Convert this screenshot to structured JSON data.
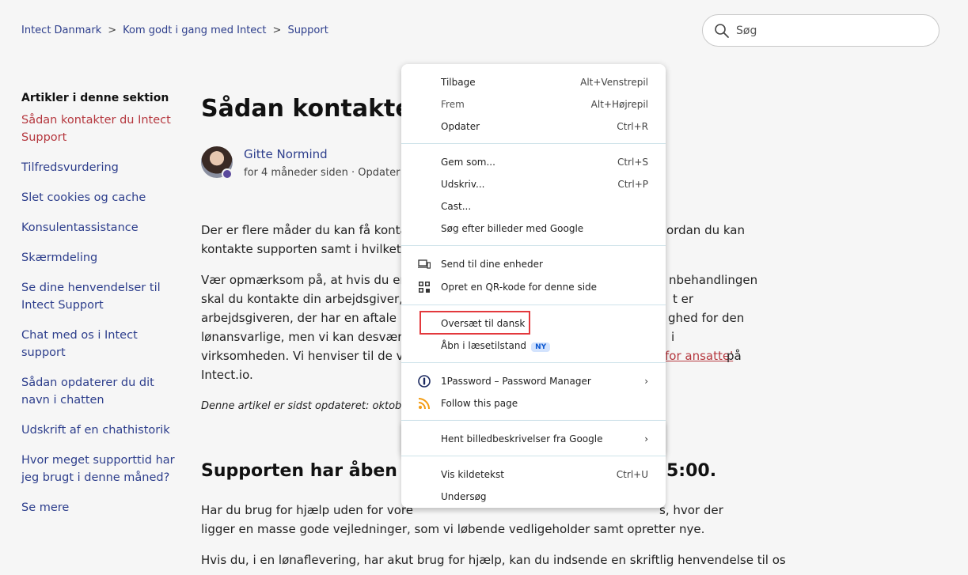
{
  "breadcrumb": {
    "item1": "Intect Danmark",
    "item2": "Kom godt i gang med Intect",
    "item3": "Support",
    "sep": ">"
  },
  "search": {
    "placeholder": "Søg"
  },
  "sidebar": {
    "heading": "Artikler i denne sektion",
    "items": [
      {
        "label": "Sådan kontakter du Intect Support"
      },
      {
        "label": "Tilfredsvurdering"
      },
      {
        "label": "Slet cookies og cache"
      },
      {
        "label": "Konsulentassistance"
      },
      {
        "label": "Skærmdeling"
      },
      {
        "label": "Se dine henvendelser til Intect Support"
      },
      {
        "label": "Chat med os i Intect support"
      },
      {
        "label": "Sådan opdaterer du dit navn i chatten"
      },
      {
        "label": "Udskrift af en chathistorik"
      },
      {
        "label": "Hvor meget supporttid har jeg brugt i denne måned?"
      },
      {
        "label": "Se mere"
      }
    ]
  },
  "article": {
    "title": "Sådan kontakter",
    "author": "Gitte Normind",
    "meta": "for 4 måneder siden  ·  Opdater",
    "p1_line1_a": "Der er flere måder du kan få konta",
    "p1_line1_b": "ordan du kan",
    "p1_line2": "kontakte supporten samt i hvilket ti",
    "p2_line1_a": "Vær opmærksom på, at hvis du er",
    "p2_line1_b": "nbehandlingen",
    "p2_line2_a": "skal du kontakte din arbejdsgiver, u",
    "p2_line2_b": "t er",
    "p2_line3_a": "arbejdsgiveren, der har en aftale m",
    "p2_line3_b": "ghed for den",
    "p2_line4_a": "lønansvarlige, men vi kan desværre",
    "p2_line4_b": "i",
    "p2_line5_a": "virksomheden. Vi henviser til de vej",
    "p2_line5_link": "for ansatte'",
    "p2_line5_b": " på",
    "p2_line6": "Intect.io.",
    "updated": "Denne artikel er sidst opdateret: oktober",
    "h2_a": "Supporten har åben alle",
    "h2_b": "5:00.",
    "p3_line1_a": "Har du brug for hjælp uden for vore",
    "p3_line1_b": "s, hvor der",
    "p3_line2": "ligger en masse gode vejledninger, som vi løbende vedligeholder samt opretter nye.",
    "p4_line1": "Hvis du, i en lønaflevering, har akut brug for hjælp,  kan du indsende en skriftlig henvendelse til os"
  },
  "menu": {
    "back": "Tilbage",
    "back_sc": "Alt+Venstrepil",
    "forward": "Frem",
    "forward_sc": "Alt+Højrepil",
    "reload": "Opdater",
    "reload_sc": "Ctrl+R",
    "save": "Gem som...",
    "save_sc": "Ctrl+S",
    "print": "Udskriv...",
    "print_sc": "Ctrl+P",
    "cast": "Cast...",
    "search_images": "Søg efter billeder med Google",
    "send_devices": "Send til dine enheder",
    "qr": "Opret en QR-kode for denne side",
    "translate": "Oversæt til dansk",
    "reader": "Åbn i læsetilstand",
    "reader_badge": "NY",
    "onepassword": "1Password – Password Manager",
    "follow": "Follow this page",
    "image_desc": "Hent billedbeskrivelser fra Google",
    "view_source": "Vis kildetekst",
    "view_source_sc": "Ctrl+U",
    "inspect": "Undersøg"
  }
}
